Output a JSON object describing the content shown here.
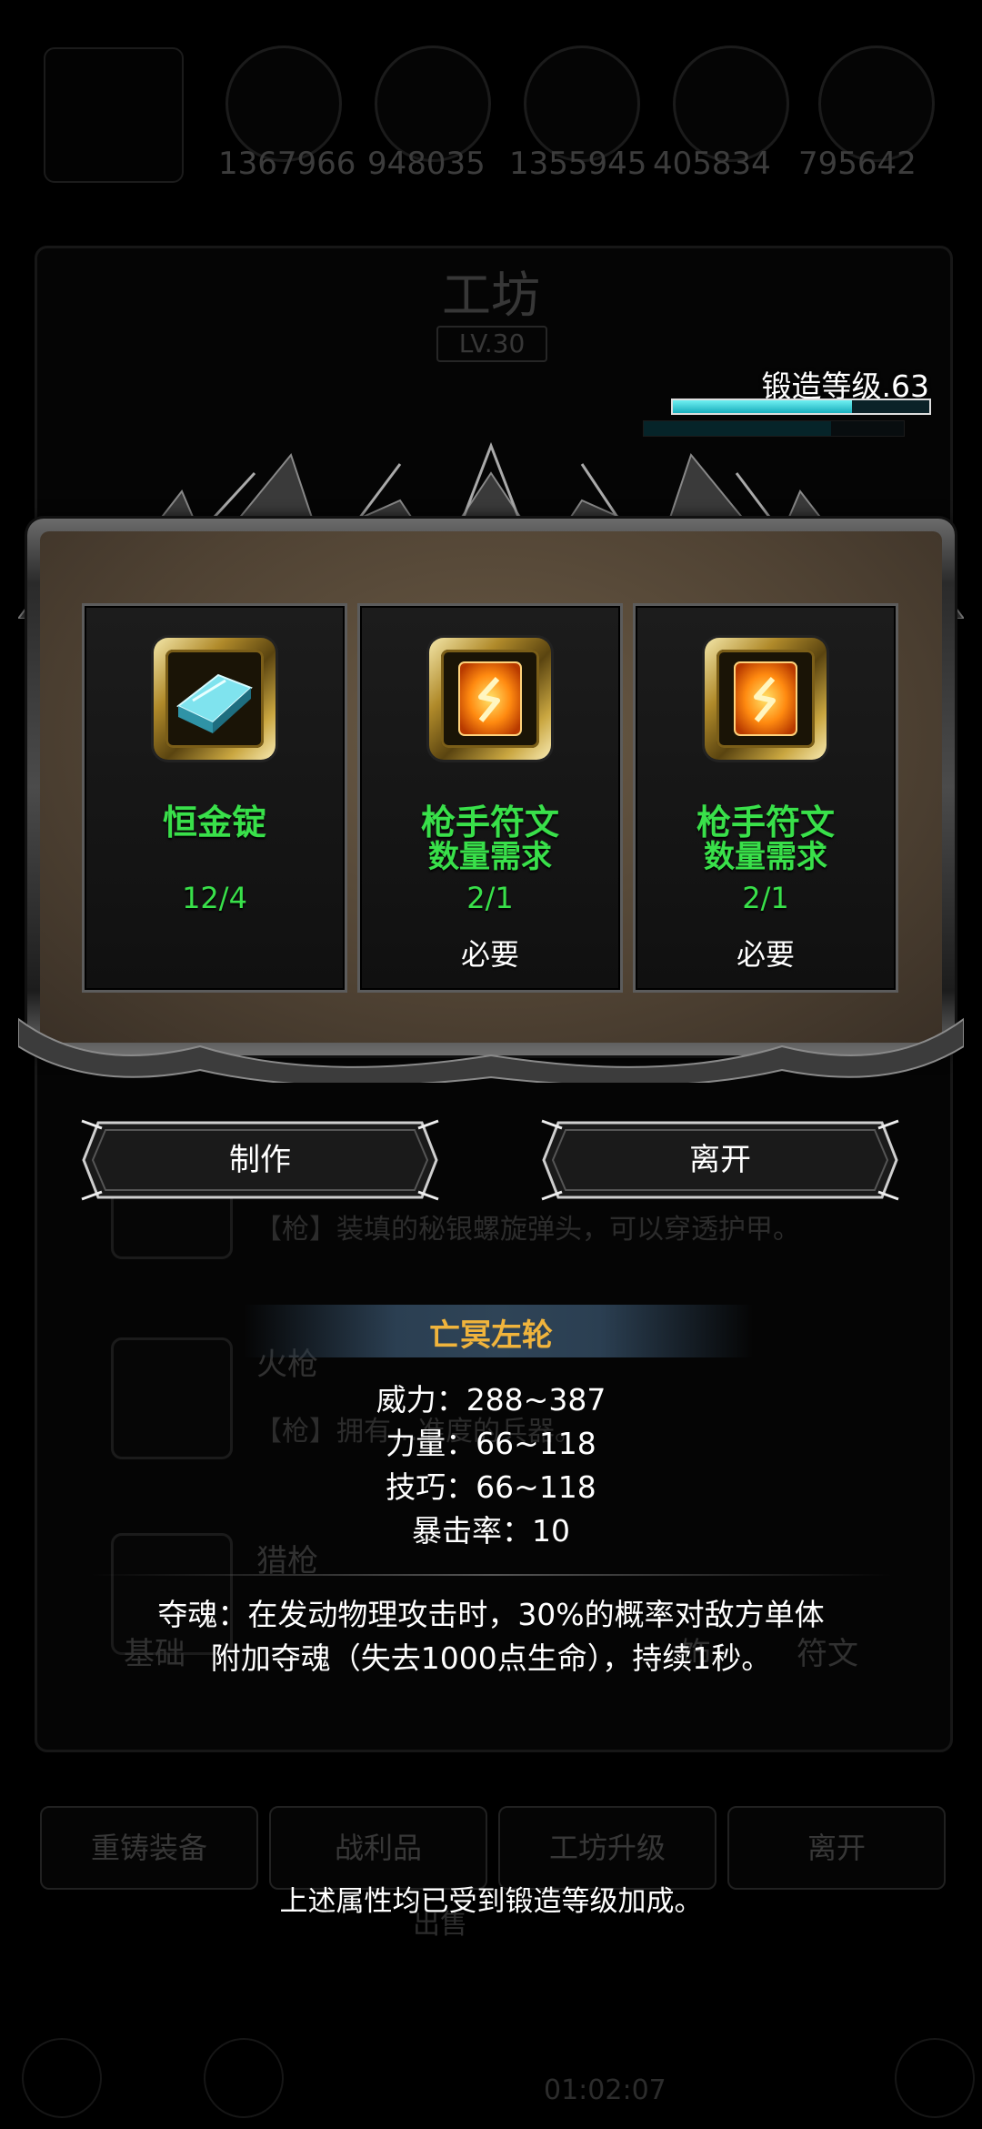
{
  "background": {
    "resources": [
      "1367966",
      "948035",
      "1355945",
      "405834",
      "795642"
    ],
    "workshop_title": "工坊",
    "workshop_level": "LV.30",
    "items": [
      {
        "title": "",
        "desc": "【枪】装填的秘银螺旋弹头，可以穿透护甲。"
      },
      {
        "title": "火枪",
        "desc": "【枪】拥有…准度的兵器。"
      },
      {
        "title": "猎枪",
        "desc": ""
      }
    ],
    "tabs": [
      "基础",
      "饰",
      "符文"
    ],
    "buttons": [
      "重铸装备",
      "战利品",
      "工坊升级",
      "离开"
    ],
    "bottom_label": "出售",
    "bottom_value": "01:02:07"
  },
  "forge": {
    "label": "锻造等级.63",
    "progress": 0.7
  },
  "materials": [
    {
      "name": "恒金锭",
      "sub": "",
      "qty": "12/4",
      "req": "",
      "icon": "ingot-icon"
    },
    {
      "name": "枪手符文",
      "sub": "数量需求",
      "qty": "2/1",
      "req": "必要",
      "icon": "rune-icon"
    },
    {
      "name": "枪手符文",
      "sub": "数量需求",
      "qty": "2/1",
      "req": "必要",
      "icon": "rune-icon"
    }
  ],
  "actions": {
    "craft": "制作",
    "leave": "离开"
  },
  "tooltip": {
    "title": "亡冥左轮",
    "stats": [
      "威力：288~387",
      "力量：66~118",
      "技巧：66~118",
      "暴击率：10"
    ],
    "skill": [
      "夺魂：在发动物理攻击时，30%的概率对敌方单体",
      "附加夺魂（失去1000点生命），持续1秒。"
    ],
    "note": "上述属性均已受到锻造等级加成。"
  },
  "colors": {
    "accent_green": "#39e04a",
    "title_gold": "#f0b43c",
    "bar_cyan": "#19aebc"
  }
}
